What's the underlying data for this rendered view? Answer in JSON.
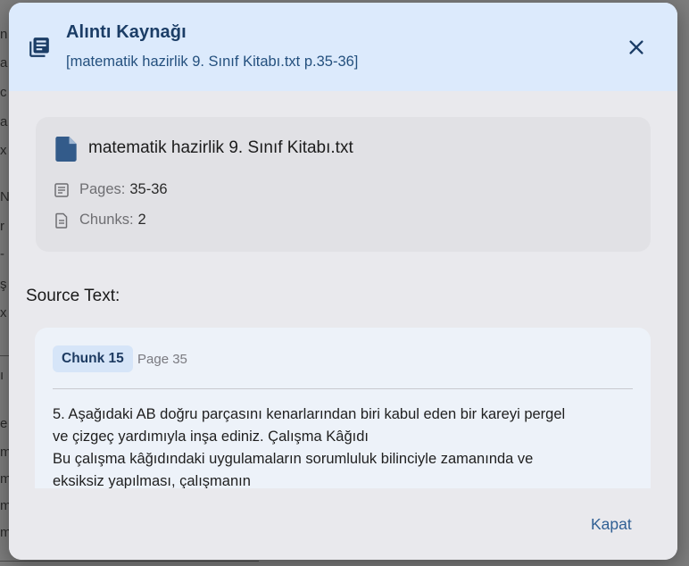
{
  "background": {
    "fragments": [
      "n",
      "a",
      "c",
      "a",
      "x",
      "N",
      "r",
      "-",
      "ş",
      "x",
      "ı",
      "e",
      "m",
      "m",
      "m",
      "m"
    ]
  },
  "dialog": {
    "title": "Alıntı Kaynağı",
    "subtitle": "[matematik hazirlik 9. Sınıf Kitabı.txt p.35-36]",
    "close_icon": "close-icon",
    "header_icon": "library-books-icon"
  },
  "file": {
    "name": "matematik hazirlik 9. Sınıf Kitabı.txt",
    "pages_label": "Pages:",
    "pages_value": "35-36",
    "chunks_label": "Chunks:",
    "chunks_value": "2"
  },
  "source": {
    "title": "Source Text:",
    "chunk_badge": "Chunk 15",
    "chunk_page": "Page 35",
    "lines": [
      "5. Aşağıdaki AB doğru parçasını kenarlarından biri kabul eden bir kareyi pergel",
      "ve çizgeç yardımıyla inşa ediniz. Çalışma Kâğıdı",
      "Bu çalışma kâğıdındaki uygulamaların sorumluluk bilinciyle zamanında ve",
      "eksiksiz yapılması, çalışmanın"
    ]
  },
  "footer": {
    "close_label": "Kapat"
  },
  "colors": {
    "header_bg": "#dceafc",
    "accent": "#1b3d66",
    "file_icon": "#335b8a",
    "chunk_badge_bg": "#d6e5f8"
  }
}
